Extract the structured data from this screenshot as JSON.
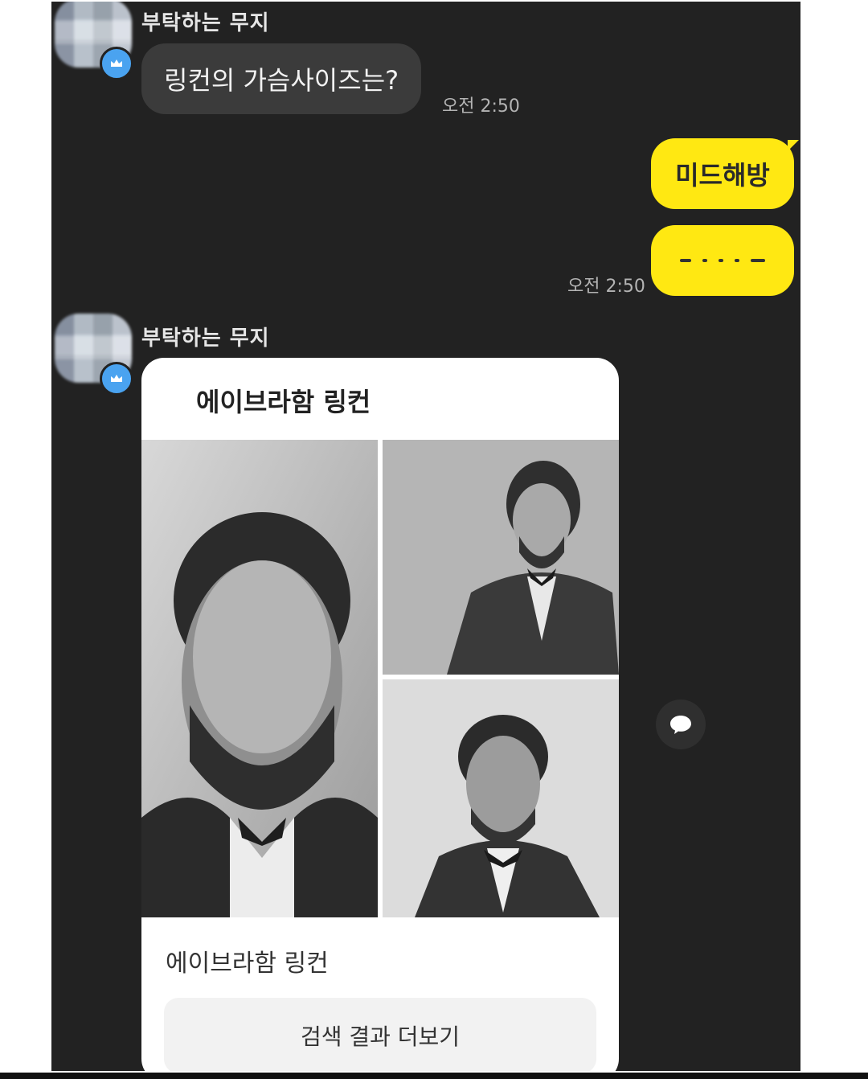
{
  "messages": {
    "first_sender": "부탁하는 무지",
    "first_text": "링컨의 가슴사이즈는?",
    "first_time": "오전 2:50",
    "reply_1": "미드해방",
    "reply_time": "오전 2:50",
    "second_sender": "부탁하는 무지"
  },
  "card": {
    "heading": "에이브라함 링컨",
    "result_title": "에이브라함 링컨",
    "more_button": "검색 결과 더보기"
  },
  "icons": {
    "avatar_badge": "crown-icon",
    "share": "speech-bubble-icon"
  },
  "colors": {
    "chat_background": "#222222",
    "outgoing_bubble": "#ffe812",
    "incoming_bubble": "#3b3b3b",
    "badge": "#4aa3f0"
  }
}
